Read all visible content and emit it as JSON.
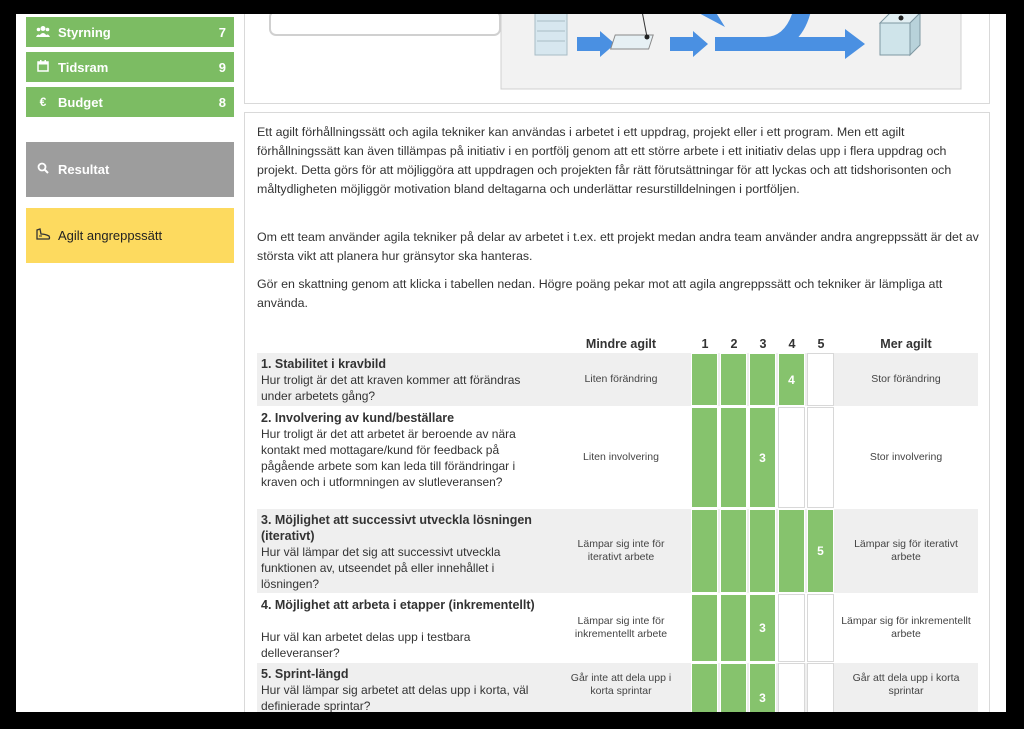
{
  "sidebar": {
    "items": [
      {
        "label": "Styrning",
        "count": "7",
        "icon": "people-icon"
      },
      {
        "label": "Tidsram",
        "count": "9",
        "icon": "calendar-icon"
      },
      {
        "label": "Budget",
        "count": "8",
        "icon": "euro-icon"
      }
    ],
    "resultat": {
      "label": "Resultat",
      "icon": "search-icon"
    },
    "agilt": {
      "label": "Agilt angreppssätt",
      "icon": "shoe-icon"
    }
  },
  "intro": {
    "p1": "Ett agilt förhållningssätt och agila tekniker kan användas i arbetet i ett uppdrag, projekt eller i ett program. Men ett agilt förhållningssätt kan även tillämpas på initiativ i en portfölj genom att ett större arbete i ett initiativ delas upp i flera uppdrag och projekt. Detta görs för att möjliggöra att uppdragen och projekten får rätt förutsättningar för att lyckas och att tidshorisonten och måltydligheten möjliggör motivation bland deltagarna och underlättar resurstilldelningen i portföljen.",
    "p2": "Om ett team använder agila tekniker på delar av arbetet i t.ex. ett projekt medan andra team använder andra angreppssätt är det av största vikt att planera hur gränsytor ska hanteras.",
    "p3": "Gör en skattning genom att klicka i tabellen nedan. Högre poäng pekar mot att agila angreppssätt och tekniker är lämpliga att använda."
  },
  "table": {
    "header_less": "Mindre agilt",
    "header_more": "Mer agilt",
    "scale": [
      "1",
      "2",
      "3",
      "4",
      "5"
    ],
    "rows": [
      {
        "title": "1. Stabilitet i kravbild",
        "desc": "Hur troligt är det att kraven kommer att förändras under arbetets gång?",
        "less": "Liten förändring",
        "more": "Stor förändring",
        "score": 4,
        "score_label": "4"
      },
      {
        "title": "2. Involvering av kund/beställare",
        "desc": "Hur troligt är det att arbetet är beroende av nära kontakt med mottagare/kund för feedback på pågående arbete som kan leda till förändringar i kraven och i utformningen av slutleveransen?",
        "less": "Liten involvering",
        "more": "Stor involvering",
        "score": 3,
        "score_label": "3"
      },
      {
        "title": "3. Möjlighet att successivt utveckla lösningen (iterativt)",
        "desc": "Hur väl lämpar det sig att successivt utveckla funktionen av, utseendet på eller innehållet i lösningen?",
        "less": "Lämpar sig inte för iterativt arbete",
        "more": "Lämpar sig för iterativt arbete",
        "score": 5,
        "score_label": "5"
      },
      {
        "title": "4. Möjlighet att arbeta i etapper (inkrementellt)",
        "desc": "Hur väl kan arbetet delas upp i testbara delleveranser?",
        "less": "Lämpar sig inte för inkrementellt arbete",
        "more": "Lämpar sig för inkrementellt arbete",
        "score": 3,
        "score_label": "3"
      },
      {
        "title": "5. Sprint-längd",
        "desc": "Hur väl lämpar sig arbetet att delas upp i korta, väl definierade sprintar?",
        "less": "Går inte att dela upp i korta sprintar",
        "more": "Går att dela upp i korta sprintar",
        "score": 3,
        "score_label": "3"
      }
    ]
  },
  "colors": {
    "green": "#7cbc63",
    "cell_green": "#86c36d",
    "gray": "#9d9d9d",
    "yellow": "#fdda5f",
    "arrow_blue": "#4a90e2"
  }
}
